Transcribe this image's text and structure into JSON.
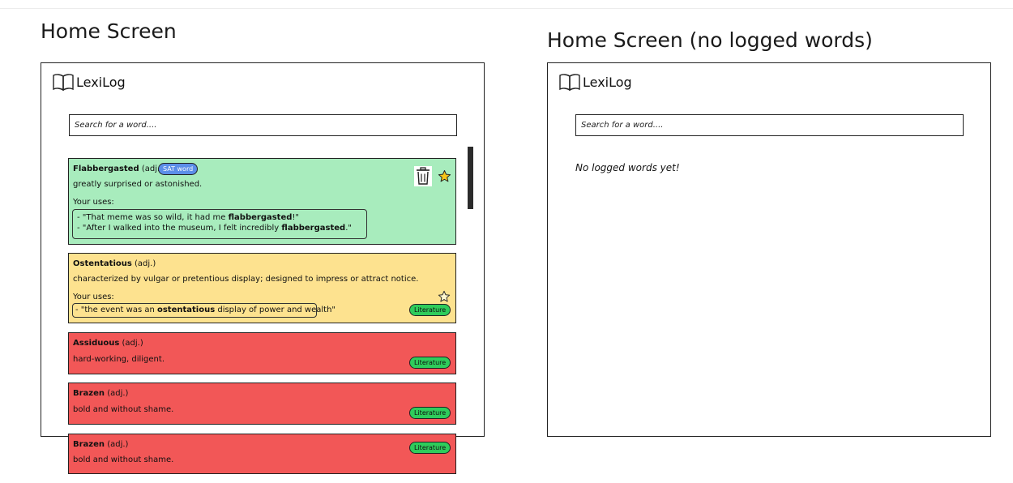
{
  "screens": [
    {
      "title": "Home Screen",
      "brand": "LexiLog",
      "search_placeholder": "Search for a word....",
      "cards": [
        {
          "word": "Flabbergasted",
          "pos": "(adj.)",
          "badge": "SAT word",
          "definition": "greatly surprised or astonished.",
          "uses_label": "Your uses:",
          "uses": [
            {
              "pre": "- \"That meme was so wild, it had me ",
              "bold": "flabbergasted",
              "post": "!\""
            },
            {
              "pre": "- \"After I walked into the museum, I felt incredibly ",
              "bold": "flabbergasted",
              "post": ".\""
            }
          ],
          "color": "#a8ecbd",
          "actions": [
            "trash-icon",
            "star-icon"
          ]
        },
        {
          "word": "Ostentatious",
          "pos": "(adj.)",
          "definition": "characterized by vulgar or pretentious display; designed to impress or attract notice.",
          "uses_label": "Your uses:",
          "uses": [
            {
              "pre": "- \"the event was an ",
              "bold": "ostentatious",
              "post": " display of power and wealth\""
            }
          ],
          "tag": "Literature",
          "color": "#fde28f",
          "actions": [
            "star-outline-icon"
          ]
        },
        {
          "word": "Assiduous",
          "pos": "(adj.)",
          "definition": "hard-working, diligent.",
          "tag": "Literature",
          "color": "#f25757"
        },
        {
          "word": "Brazen",
          "pos": "(adj.)",
          "definition": "bold and without shame.",
          "tag": "Literature",
          "color": "#f25757"
        },
        {
          "word": "Brazen",
          "pos": "(adj.)",
          "definition": "bold and without shame.",
          "tag": "Literature",
          "color": "#f25757"
        }
      ]
    },
    {
      "title": "Home Screen (no logged words)",
      "brand": "LexiLog",
      "search_placeholder": "Search for a word....",
      "empty_message": "No logged words yet!"
    }
  ],
  "icons": {
    "brand": "open-book-icon",
    "trash": "trash-icon",
    "star": "star-icon"
  },
  "colors": {
    "green_card": "#a8ecbd",
    "yellow_card": "#fde28f",
    "red_card": "#f25757",
    "sat_badge": "#5b8ee8",
    "literature_tag": "#2ecc5b",
    "star": "#f5c518"
  }
}
